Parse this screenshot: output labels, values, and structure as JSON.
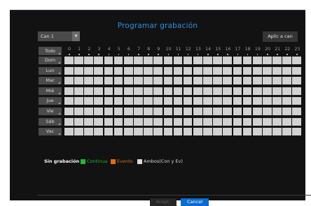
{
  "dialog": {
    "title": "Programar grabación",
    "channel_select": {
      "value": "Can 1",
      "arrow": "▼"
    },
    "apply_button": "Aplic a can",
    "all_button": "Todo",
    "days": [
      "Dom",
      "Lun",
      "Mar",
      "Mié",
      "Jue",
      "Vie",
      "Sáb",
      "Vac"
    ],
    "hours": [
      "0",
      "1",
      "2",
      "3",
      "4",
      "5",
      "6",
      "7",
      "8",
      "9",
      "10",
      "11",
      "12",
      "13",
      "14",
      "15",
      "16",
      "17",
      "18",
      "19",
      "20",
      "21",
      "22",
      "23"
    ],
    "schedule_cell_color": "#d2d2d2",
    "legend": [
      {
        "label": "Sin grabación",
        "color": "#121212",
        "text_color": "#ffffff",
        "bold": true
      },
      {
        "label": "Continua",
        "color": "#23b53a",
        "text_color": "#23b53a",
        "bold": false
      },
      {
        "label": "Evento",
        "color": "#e36b10",
        "text_color": "#e36b10",
        "bold": false
      },
      {
        "label": "Ambos(Con y Ev)",
        "color": "#d8d8d8",
        "text_color": "#d8d8d8",
        "bold": false
      }
    ],
    "accept_button": "Acept.",
    "cancel_button": "Cancel"
  }
}
